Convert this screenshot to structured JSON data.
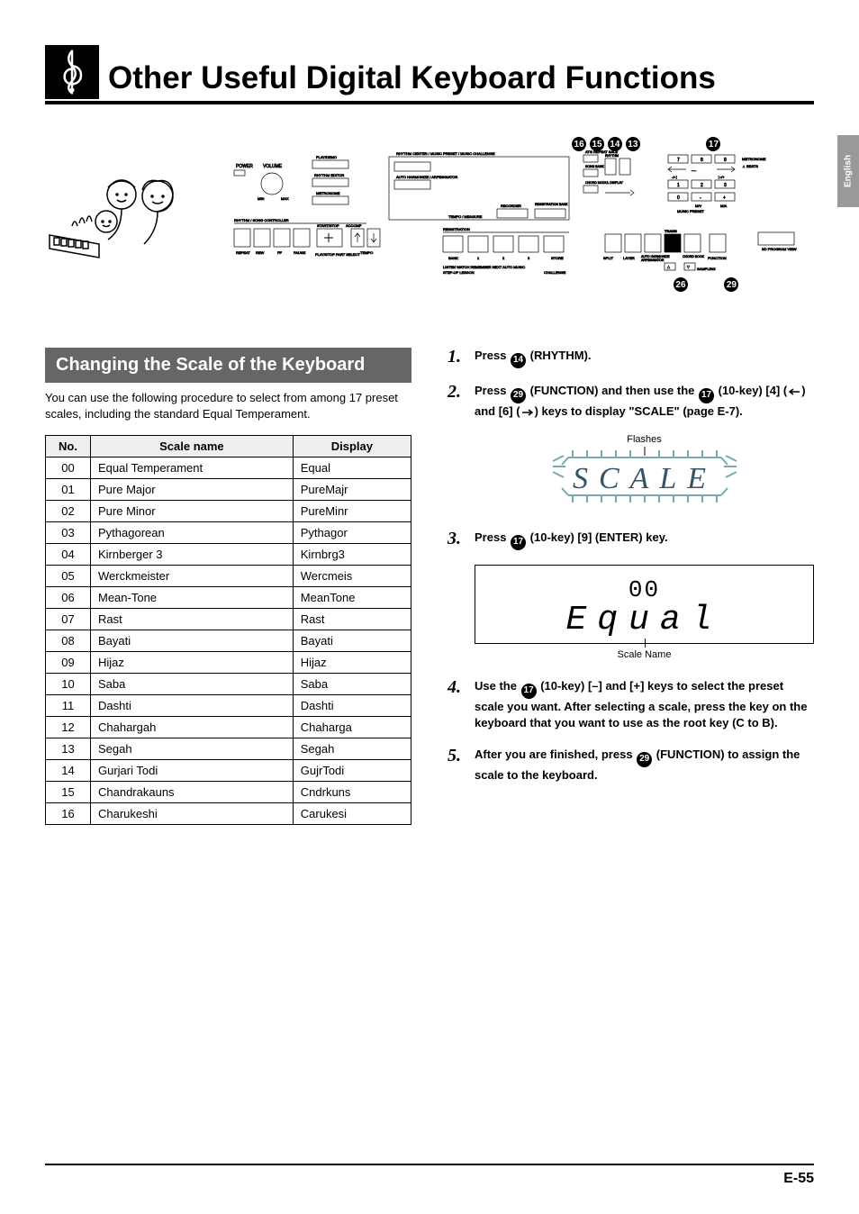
{
  "sideTab": "English",
  "pageTitle": "Other Useful Digital Keyboard Functions",
  "diagramBadges": [
    "16",
    "15",
    "14",
    "13",
    "17",
    "26",
    "29"
  ],
  "section": {
    "header": "Changing the Scale of the Keyboard",
    "intro": "You can use the following procedure to select from among 17 preset scales, including the standard Equal Temperament."
  },
  "tableHeaders": {
    "no": "No.",
    "name": "Scale name",
    "display": "Display"
  },
  "scales": [
    {
      "no": "00",
      "name": "Equal Temperament",
      "display": "Equal"
    },
    {
      "no": "01",
      "name": "Pure Major",
      "display": "PureMajr"
    },
    {
      "no": "02",
      "name": "Pure Minor",
      "display": "PureMinr"
    },
    {
      "no": "03",
      "name": "Pythagorean",
      "display": "Pythagor"
    },
    {
      "no": "04",
      "name": "Kirnberger 3",
      "display": "Kirnbrg3"
    },
    {
      "no": "05",
      "name": "Werckmeister",
      "display": "Wercmeis"
    },
    {
      "no": "06",
      "name": "Mean-Tone",
      "display": "MeanTone"
    },
    {
      "no": "07",
      "name": "Rast",
      "display": "Rast"
    },
    {
      "no": "08",
      "name": "Bayati",
      "display": "Bayati"
    },
    {
      "no": "09",
      "name": "Hijaz",
      "display": "Hijaz"
    },
    {
      "no": "10",
      "name": "Saba",
      "display": "Saba"
    },
    {
      "no": "11",
      "name": "Dashti",
      "display": "Dashti"
    },
    {
      "no": "12",
      "name": "Chahargah",
      "display": "Chaharga"
    },
    {
      "no": "13",
      "name": "Segah",
      "display": "Segah"
    },
    {
      "no": "14",
      "name": "Gurjari Todi",
      "display": "GujrTodi"
    },
    {
      "no": "15",
      "name": "Chandrakauns",
      "display": "Cndrkuns"
    },
    {
      "no": "16",
      "name": "Charukeshi",
      "display": "Carukesi"
    }
  ],
  "steps": {
    "s1": {
      "num": "1.",
      "pre": "Press ",
      "badge": "14",
      "post": " (RHYTHM)."
    },
    "s2": {
      "num": "2.",
      "pre": "Press ",
      "badge1": "29",
      "mid1": " (FUNCTION) and then use the ",
      "badge2": "17",
      "mid2": " (10-key) [4] (",
      "mid3": ") and [6] (",
      "mid4": ") keys to display \"SCALE\" (page E-7)."
    },
    "s2_display": {
      "flashes": "Flashes",
      "text": "SCALE"
    },
    "s3": {
      "num": "3.",
      "pre": "Press ",
      "badge": "17",
      "post": " (10-key) [9] (ENTER) key."
    },
    "s3_display": {
      "num": "00",
      "text": "Equal",
      "caption": "Scale Name"
    },
    "s4": {
      "num": "4.",
      "pre": "Use the ",
      "badge": "17",
      "post": " (10-key) [–] and [+] keys to select the preset scale you want. After selecting a scale, press the key on the keyboard that you want to use as the root key (C to B)."
    },
    "s5": {
      "num": "5.",
      "pre": "After you are finished, press ",
      "badge": "29",
      "post": " (FUNCTION) to assign the scale to the keyboard."
    }
  },
  "footer": "E-55"
}
